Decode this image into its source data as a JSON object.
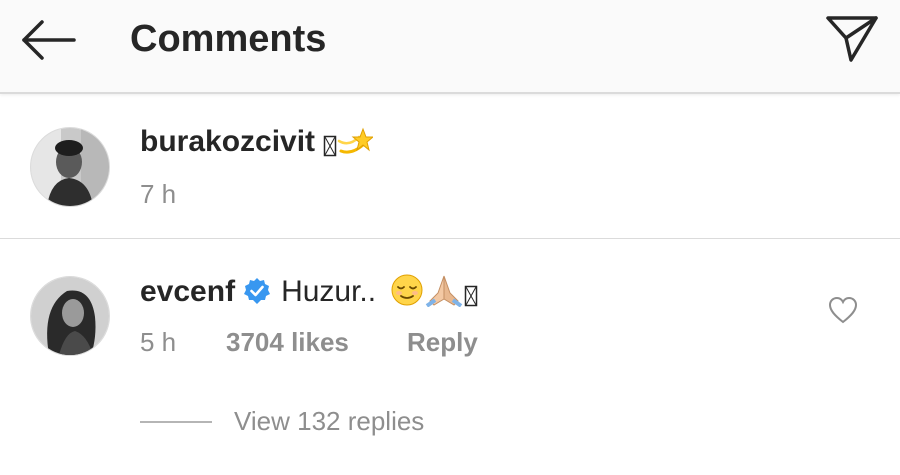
{
  "header": {
    "title": "Comments",
    "back_icon": "arrow-left-icon",
    "share_icon": "send-direct-icon"
  },
  "comments": [
    {
      "username": "burakozcivit",
      "text": " ",
      "time": "7 h",
      "emoji": [
        "missing-glyph-box",
        "dizzy-star-emoji"
      ]
    },
    {
      "username": "evcenf",
      "verified": true,
      "text": "Huzur..",
      "time": "5 h",
      "likes": "3704 likes",
      "reply_label": "Reply",
      "emoji": [
        "relieved-face-emoji",
        "folded-hands-emoji",
        "missing-glyph-box"
      ]
    }
  ],
  "view_replies": "View 132 replies",
  "colors": {
    "text": "#262626",
    "secondary": "#8e8e8e",
    "verified": "#3897f0",
    "divider": "#dbdbdb",
    "header_bg": "#fafafa"
  }
}
